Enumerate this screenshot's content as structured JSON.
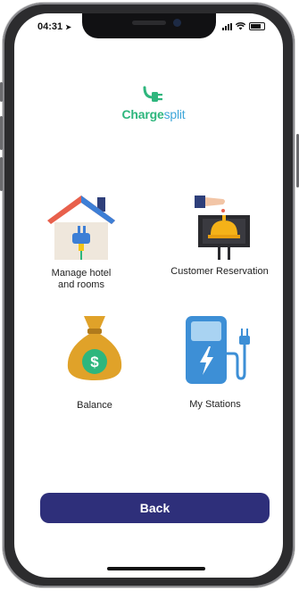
{
  "status_bar": {
    "time": "04:31"
  },
  "logo": {
    "part1": "Charge",
    "part2": "split"
  },
  "menu": [
    {
      "label": "Manage hotel\nand rooms",
      "icon": "house-plug-icon"
    },
    {
      "label": "Customer Reservation",
      "icon": "reception-bell-icon"
    },
    {
      "label": "Balance",
      "icon": "money-bag-icon"
    },
    {
      "label": "My Stations",
      "icon": "charging-station-icon"
    }
  ],
  "back_button": {
    "label": "Back"
  },
  "colors": {
    "brand_green": "#2eb67d",
    "brand_blue": "#3da6d9",
    "button": "#2e2f7a"
  }
}
